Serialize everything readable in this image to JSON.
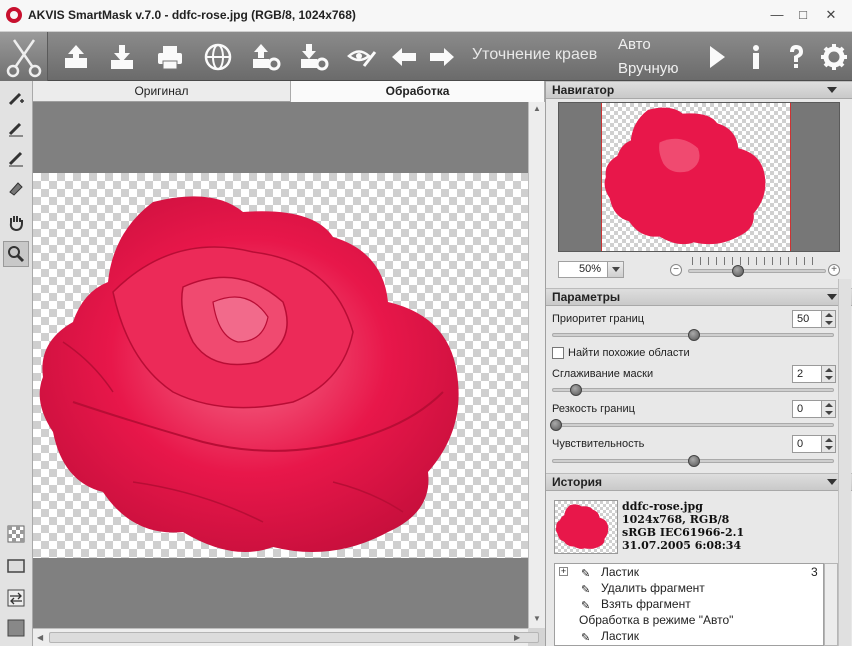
{
  "window": {
    "title": "AKVIS SmartMask v.7.0 - ddfc-rose.jpg (RGB/8, 1024x768)",
    "minimize": "—",
    "maximize": "□",
    "close": "✕"
  },
  "toolbar": {
    "refine_edges_label": "Уточнение краев",
    "mode_auto": "Авто",
    "mode_manual": "Вручную"
  },
  "tabs": {
    "original": "Оригинал",
    "processing": "Обработка"
  },
  "navigator": {
    "title": "Навигатор",
    "zoom": "50%",
    "zoom_out": "−",
    "zoom_in": "+"
  },
  "params": {
    "title": "Параметры",
    "edge_priority_label": "Приоритет границ",
    "edge_priority_value": "50",
    "find_similar_label": "Найти похожие области",
    "find_similar_checked": false,
    "mask_smoothing_label": "Сглаживание маски",
    "mask_smoothing_value": "2",
    "edge_sharpness_label": "Резкость границ",
    "edge_sharpness_value": "0",
    "sensitivity_label": "Чувствительность",
    "sensitivity_value": "0"
  },
  "history": {
    "title": "История",
    "file_name": "ddfc-rose.jpg",
    "file_dims": "1024x768, RGB/8",
    "file_profile": "sRGB IEC61966-2.1",
    "file_date": "31.07.2005 6:08:34",
    "items": [
      {
        "label": "Ластик",
        "count": "3"
      },
      {
        "label": "Удалить фрагмент"
      },
      {
        "label": "Взять фрагмент"
      },
      {
        "label": "Обработка в режиме \"Авто\""
      },
      {
        "label": "Ластик"
      }
    ]
  },
  "colors": {
    "rose": "#e8174a",
    "rose_dark": "#b80d35",
    "toolbar_bg": "#7a7a7a"
  }
}
